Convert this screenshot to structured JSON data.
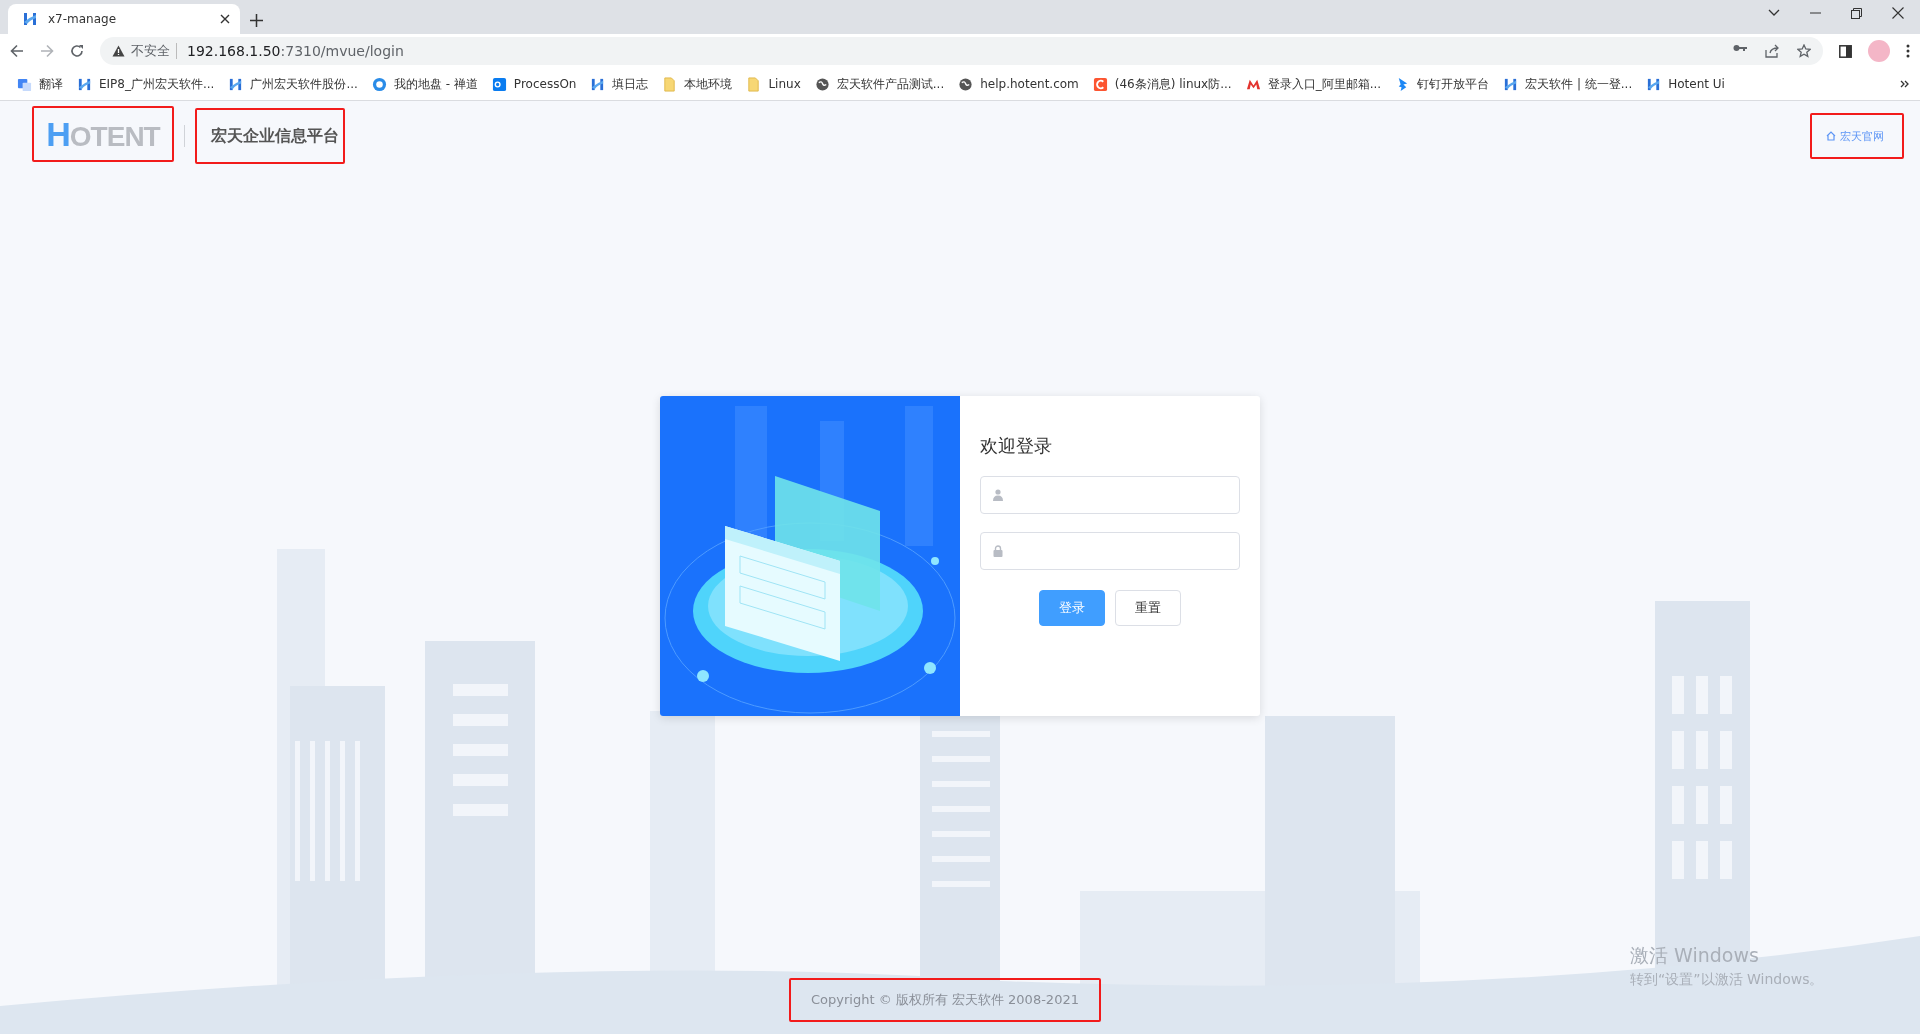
{
  "browser": {
    "tabs": [
      {
        "title": "x7-manage",
        "selected": true
      }
    ],
    "address": {
      "security_label": "不安全",
      "url_host": "192.168.1.50",
      "url_path": ":7310/mvue/login"
    },
    "bookmarks": [
      {
        "label": "翻译",
        "kind": "translate"
      },
      {
        "label": "EIP8_广州宏天软件...",
        "kind": "hotent"
      },
      {
        "label": "广州宏天软件股份...",
        "kind": "hotent"
      },
      {
        "label": "我的地盘 - 禅道",
        "kind": "zentao"
      },
      {
        "label": "ProcessOn",
        "kind": "processon"
      },
      {
        "label": "填日志",
        "kind": "hotent"
      },
      {
        "label": "本地环境",
        "kind": "folder"
      },
      {
        "label": "Linux",
        "kind": "folder"
      },
      {
        "label": "宏天软件产品测试...",
        "kind": "globe"
      },
      {
        "label": "help.hotent.com",
        "kind": "globe"
      },
      {
        "label": "(46条消息) linux防...",
        "kind": "csdn"
      },
      {
        "label": "登录入口_阿里邮箱...",
        "kind": "mail"
      },
      {
        "label": "钉钉开放平台",
        "kind": "dingtalk"
      },
      {
        "label": "宏天软件 | 统一登...",
        "kind": "hotent"
      },
      {
        "label": "Hotent Ui",
        "kind": "hotent"
      }
    ]
  },
  "header": {
    "logo": "HOTENT",
    "title": "宏天企业信息平台",
    "site_link": "宏天官网"
  },
  "login": {
    "title": "欢迎登录",
    "fields": [
      {
        "kind": "user"
      },
      {
        "kind": "password"
      }
    ],
    "buttons": [
      {
        "label": "登录",
        "kind": "primary"
      },
      {
        "label": "重置",
        "kind": "default"
      }
    ]
  },
  "footer": {
    "copyright": "Copyright © 版权所有 宏天软件 2008-2021"
  },
  "os_watermark": {
    "title": "激活 Windows",
    "subtitle": "转到“设置”以激活 Windows。"
  }
}
